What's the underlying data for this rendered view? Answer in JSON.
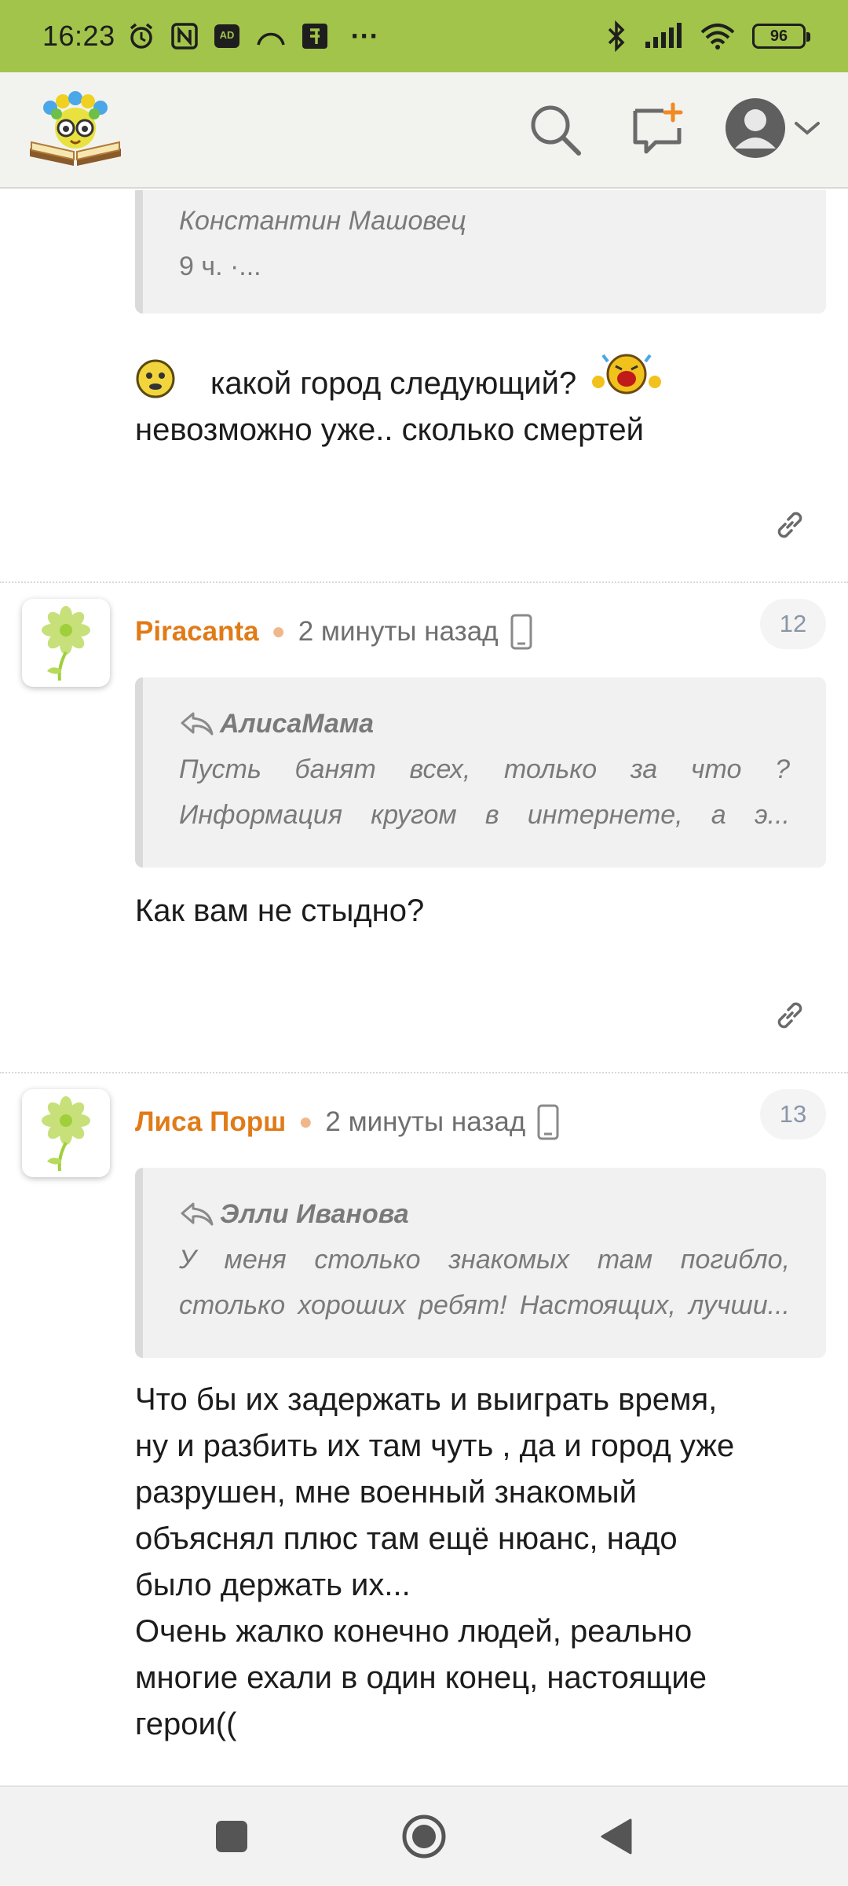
{
  "status_bar": {
    "time": "16:23",
    "battery": "96",
    "icons": [
      "alarm-icon",
      "nfc-icon",
      "ad-icon",
      "arc-icon",
      "app-icon",
      "more-icon",
      "bluetooth-icon",
      "signal-icon",
      "wifi-icon",
      "battery-icon"
    ],
    "more": "···"
  },
  "app_bar": {
    "logo": "site-logo",
    "search": "search-icon",
    "new_post": "new-post-icon",
    "profile": "profile-icon"
  },
  "quote0": {
    "author": "Константин Машовец",
    "meta": "9 ч. ·..."
  },
  "post0": {
    "line1": "какой город следующий?",
    "line2": "невозможно уже.. сколько смертей"
  },
  "comments": [
    {
      "author": "Piracanta",
      "time": "2 минуты назад",
      "number": "12",
      "quote_author": "АлисаМама",
      "quote_line1": "Пусть банят всех, только за что ?",
      "quote_line2": "Информация кругом в интернете, а э...",
      "body": "Как вам не стыдно?"
    },
    {
      "author": "Лиса Порш",
      "time": "2 минуты назад",
      "number": "13",
      "quote_author": "Элли Иванова",
      "quote_line1": "У меня столько знакомых там погибло,",
      "quote_line2": "столько хороших ребят! Настоящих, лучши...",
      "body": [
        "Что бы их задержать и выиграть время,",
        "ну и разбить их там чуть , да и город уже",
        "разрушен, мне военный знакомый",
        "объяснял плюс там ещё нюанс, надо",
        "было держать их...",
        "Очень жалко конечно людей, реально",
        "многие ехали в один конец, настоящие",
        "герои(("
      ]
    }
  ],
  "colors": {
    "status_bar": "#a2c44a",
    "author": "#e07b18",
    "header_bg": "#f2f3ee"
  }
}
